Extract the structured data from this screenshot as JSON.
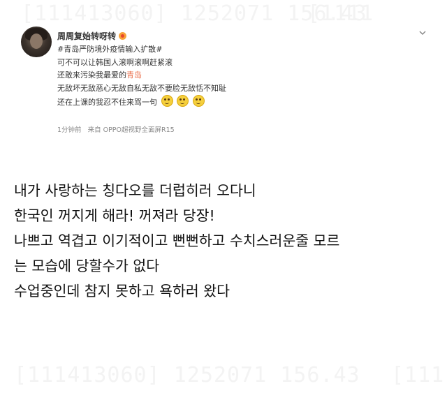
{
  "post": {
    "username": "周周复始转呀转",
    "hashtag": "#青岛严防境外疫情输入扩散#",
    "lines": [
      "可不可以让韩国人滚啊滚啊赶紧滚",
      "还敢来污染我最爱的",
      "无敌坏无敌恶心无敌自私无敌不要脸无敌恬不知耻",
      "还在上课的我忍不住来骂一句"
    ],
    "highlight_word": "青岛",
    "time": "1分钟前",
    "source": "来自 OPPO超视野全面屏R15"
  },
  "caption": {
    "lines": [
      "내가 사랑하는 칭다오를 더럽히러 오다니",
      "한국인 꺼지게 해라! 꺼져라 당장!",
      "나쁘고 역겹고 이기적이고 뻔뻔하고 수치스러운줄 모르",
      "는 모습에 당할수가 없다",
      "수업중인데 참지 못하고 욕하러 왔다"
    ]
  },
  "colors": {
    "hashtag": "#eb7350",
    "meta": "#8a8a8a"
  }
}
